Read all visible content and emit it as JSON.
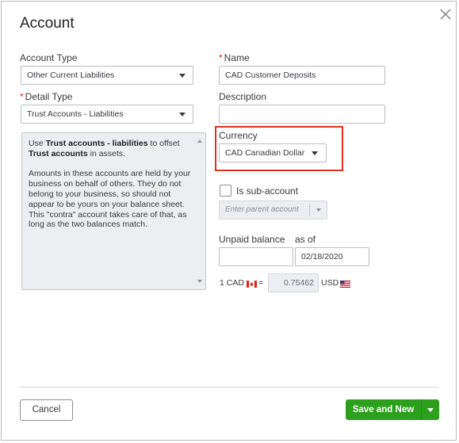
{
  "dialog": {
    "title": "Account",
    "close_icon": "close-icon"
  },
  "account_type": {
    "label": "Account Type",
    "value": "Other Current Liabilities"
  },
  "detail_type": {
    "required_mark": "*",
    "label": "Detail Type",
    "value": "Trust Accounts - Liabilities"
  },
  "help": {
    "p1_pre": "Use ",
    "p1_bold1": "Trust accounts - liabilities",
    "p1_mid": " to offset ",
    "p1_bold2": "Trust accounts",
    "p1_post": " in assets.",
    "p2": "Amounts in these accounts are held by your business on behalf of others. They do not belong to your business, so should not appear to be yours on your balance sheet. This \"contra\" account takes care of that, as long as the two balances match."
  },
  "name": {
    "required_mark": "*",
    "label": "Name",
    "value": "CAD Customer Deposits"
  },
  "description": {
    "label": "Description",
    "value": ""
  },
  "currency": {
    "label": "Currency",
    "value": "CAD Canadian Dollar",
    "highlight_color": "#e0301e"
  },
  "sub_account": {
    "label": "Is sub-account",
    "checked": false,
    "parent_placeholder": "Enter parent account"
  },
  "unpaid_balance": {
    "label": "Unpaid balance",
    "value": "",
    "as_of_label": "as of",
    "date": "02/18/2020"
  },
  "exchange": {
    "from_prefix": "1 CAD",
    "equals": "=",
    "rate": "0.75462",
    "to_currency": "USD"
  },
  "footer": {
    "cancel_label": "Cancel",
    "save_label": "Save and New",
    "save_color": "#2ca01c"
  }
}
